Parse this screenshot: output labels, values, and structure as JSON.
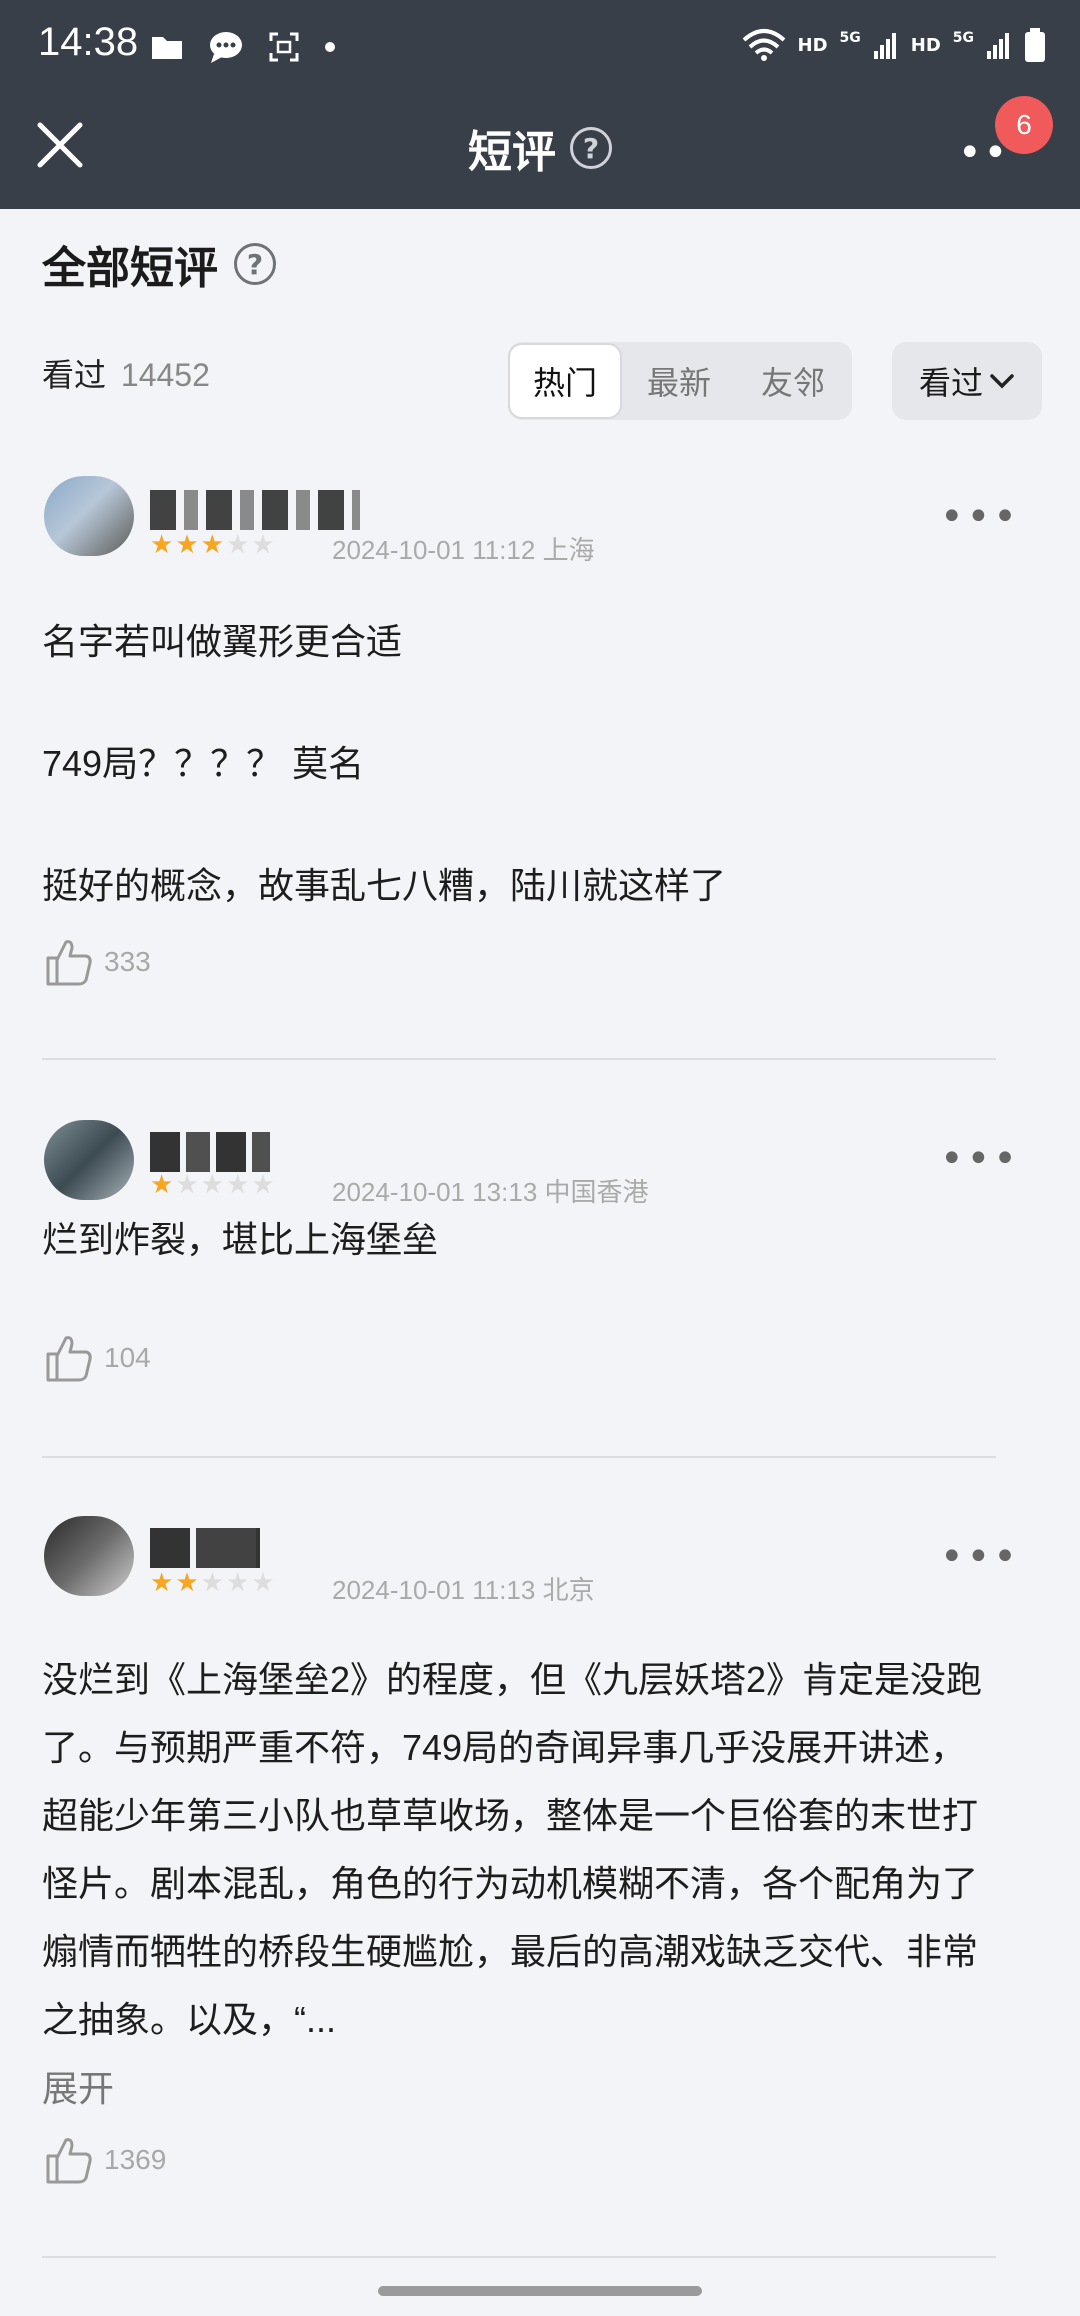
{
  "status_bar": {
    "time": "14:38",
    "net1": "HD",
    "net1_gen": "5G",
    "net2": "HD",
    "net2_gen": "5G"
  },
  "header": {
    "title": "短评",
    "help": "?",
    "badge": "6",
    "more": "••"
  },
  "section": {
    "title": "全部短评",
    "help": "?"
  },
  "seen": {
    "label": "看过",
    "count": "14452"
  },
  "sort_tabs": [
    {
      "label": "热门",
      "active": true
    },
    {
      "label": "最新",
      "active": false
    },
    {
      "label": "友邻",
      "active": false
    }
  ],
  "filter": {
    "label": "看过"
  },
  "reviews": [
    {
      "meta": "2024-10-01 11:12 上海",
      "stars": 3,
      "paragraphs": [
        "名字若叫做翼形更合适",
        "749局？？？？ 莫名",
        "挺好的概念，故事乱七八糟，陆川就这样了"
      ],
      "likes": "333"
    },
    {
      "meta": "2024-10-01 13:13 中国香港",
      "stars": 1,
      "paragraphs": [
        "烂到炸裂，堪比上海堡垒"
      ],
      "likes": "104"
    },
    {
      "meta": "2024-10-01 11:13 北京",
      "stars": 2,
      "text": "没烂到《上海堡垒2》的程度，但《九层妖塔2》肯定是没跑了。与预期严重不符，749局的奇闻异事几乎没展开讲述，超能少年第三小队也草草收场，整体是一个巨俗套的末世打怪片。剧本混乱，角色的行为动机模糊不清，各个配角为了煽情而牺牲的桥段生硬尴尬，最后的高潮戏缺乏交代、非常之抽象。以及，“...",
      "expand": "展开",
      "likes": "1369"
    }
  ],
  "colors": {
    "header_bg": "#393f48",
    "page_bg": "#f3f4f8",
    "badge": "#f05a5a",
    "star": "#f5a623"
  }
}
